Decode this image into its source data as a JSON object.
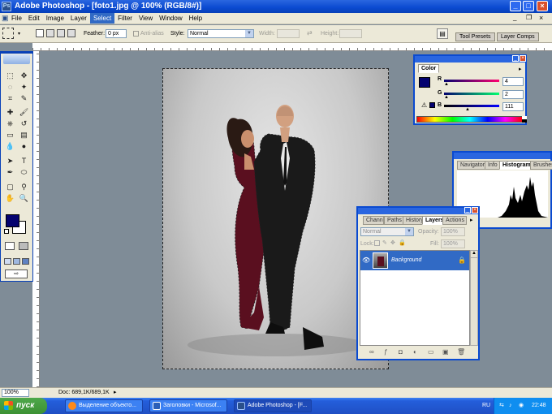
{
  "window": {
    "title": "Adobe Photoshop - [foto1.jpg @ 100% (RGB/8#)]",
    "app_icon": "Ps"
  },
  "menu": [
    "File",
    "Edit",
    "Image",
    "Layer",
    "Select",
    "Filter",
    "View",
    "Window",
    "Help"
  ],
  "menu_active": "Select",
  "options": {
    "feather_label": "Feather:",
    "feather_value": "0 px",
    "antialias_label": "Anti-alias",
    "style_label": "Style:",
    "style_value": "Normal",
    "width_label": "Width:",
    "height_label": "Height:",
    "tabs": [
      "Tool Presets",
      "Layer Comps"
    ]
  },
  "color_panel": {
    "tab": "Color",
    "r_label": "R",
    "r_value": "4",
    "g_label": "G",
    "g_value": "2",
    "b_label": "B",
    "b_value": "111",
    "warning_icon": "warning-icon"
  },
  "histogram_panel": {
    "tabs": [
      "Navigator",
      "Info",
      "Histogram",
      "Brushes"
    ],
    "active_tab": "Histogram"
  },
  "layers_panel": {
    "tabs": [
      "Channels",
      "Paths",
      "History",
      "Layers",
      "Actions"
    ],
    "active_tab": "Layers",
    "blend_mode": "Normal",
    "opacity_label": "Opacity:",
    "opacity_value": "100%",
    "lock_label": "Lock:",
    "fill_label": "Fill:",
    "fill_value": "100%",
    "layer_name": "Background"
  },
  "status": {
    "zoom": "100%",
    "doc": "Doc: 689,1K/689,1K"
  },
  "taskbar": {
    "start_label": "пуск",
    "tasks": [
      "Выделение объекто...",
      "Заголовки - Microsof...",
      "Adobe Photoshop - [F..."
    ],
    "lang": "RU",
    "time": "22:48"
  },
  "colors": {
    "foreground": "#04026f",
    "background": "#ffffff",
    "selection_bar": "#316ac5"
  }
}
